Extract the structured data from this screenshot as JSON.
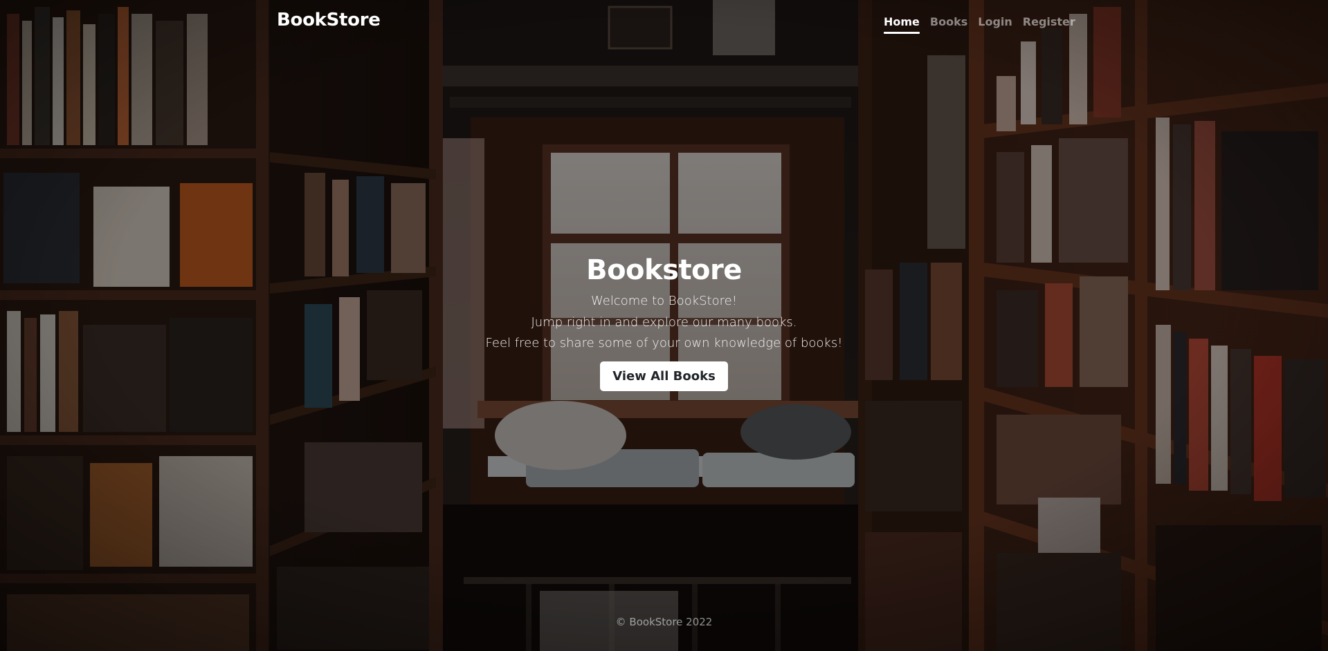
{
  "brand": "BookStore",
  "nav": {
    "home": "Home",
    "books": "Books",
    "login": "Login",
    "register": "Register"
  },
  "hero": {
    "title": "Bookstore",
    "lines": [
      "Welcome to BookStore!",
      "Jump right in and explore our many books.",
      "Feel free to share some of your own knowledge of books!"
    ],
    "button": "View All Books"
  },
  "footer": "© BookStore 2022",
  "colors": {
    "text": "#ffffff",
    "muted_nav": "rgba(255,255,255,0.5)",
    "button_bg": "#ffffff",
    "button_text": "#212529"
  },
  "icons": {
    "background": "bookstore-reading-nook-photo"
  }
}
